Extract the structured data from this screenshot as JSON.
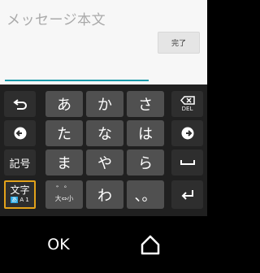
{
  "compose": {
    "placeholder": "メッセージ本文",
    "done_label": "完了"
  },
  "keyboard": {
    "left_column": [
      "symbols-label"
    ],
    "symbols_label": "記号",
    "mode_main": "文字",
    "mode_sub_hl": "あ",
    "mode_sub_rest": "A 1",
    "delete_label": "DEL",
    "rows": [
      [
        "あ",
        "か",
        "さ"
      ],
      [
        "た",
        "な",
        "は"
      ],
      [
        "ま",
        "や",
        "ら"
      ]
    ],
    "bottom_row": {
      "dakuten": "゛゜",
      "case_label": "大⇔小",
      "wa": "わ",
      "punct": "、。"
    },
    "accent_color": "#e3a21a",
    "underline_color": "#1b9aaa"
  },
  "navbar": {
    "ok_label": "OK"
  }
}
